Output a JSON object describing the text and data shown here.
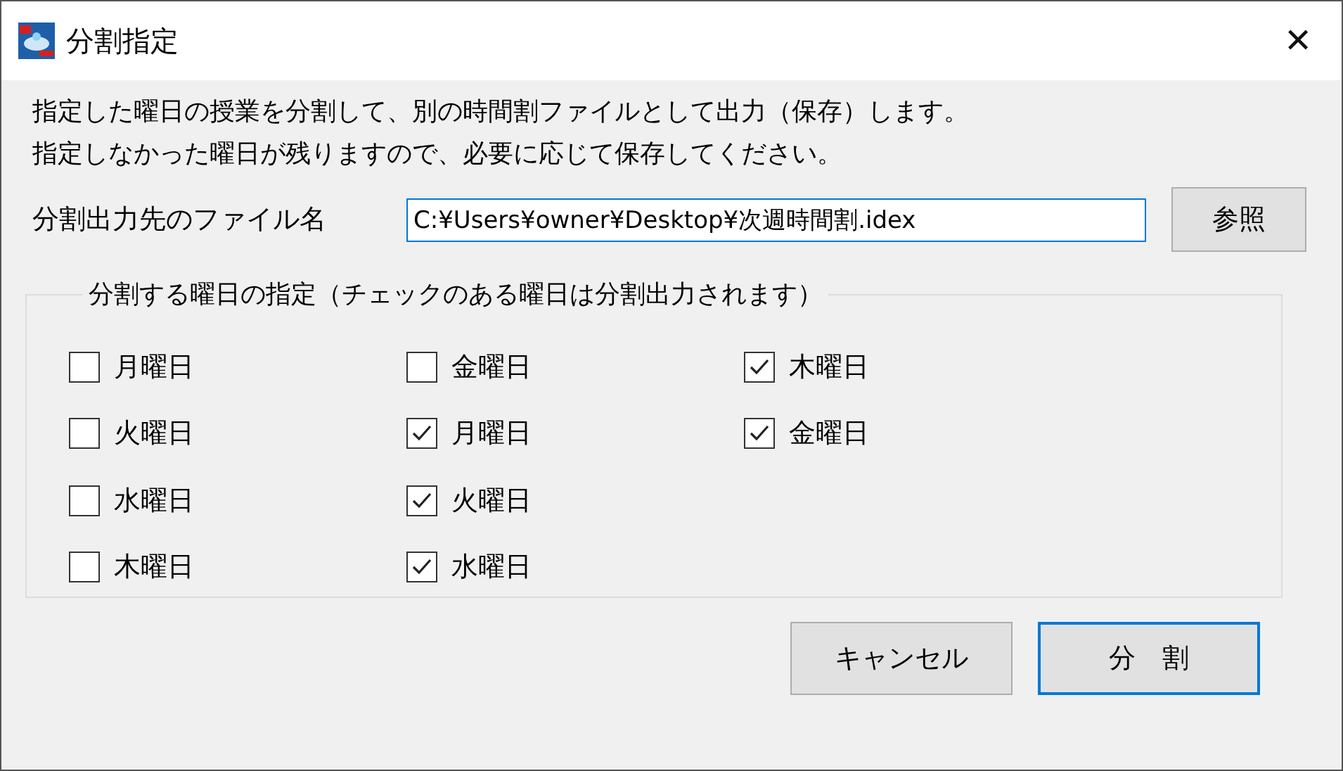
{
  "window": {
    "title": "分割指定",
    "close": "✕"
  },
  "description": [
    "指定した曜日の授業を分割して、別の時間割ファイルとして出力（保存）します。",
    "指定しなかった曜日が残りますので、必要に応じて保存してください。"
  ],
  "output_file": {
    "label": "分割出力先のファイル名",
    "value": "C:¥Users¥owner¥Desktop¥次週時間割.idex",
    "browse_button": "参照"
  },
  "day_group": {
    "title": "分割する曜日の指定（チェックのある曜日は分割出力されます）",
    "days": [
      {
        "label": "月曜日",
        "checked": false
      },
      {
        "label": "火曜日",
        "checked": false
      },
      {
        "label": "水曜日",
        "checked": false
      },
      {
        "label": "木曜日",
        "checked": false
      },
      {
        "label": "金曜日",
        "checked": false
      },
      {
        "label": "月曜日",
        "checked": true
      },
      {
        "label": "火曜日",
        "checked": true
      },
      {
        "label": "水曜日",
        "checked": true
      },
      {
        "label": "木曜日",
        "checked": true
      },
      {
        "label": "金曜日",
        "checked": true
      }
    ]
  },
  "buttons": [
    {
      "label": "キャンセル",
      "default": false
    },
    {
      "label": "分　割",
      "default": true
    }
  ]
}
